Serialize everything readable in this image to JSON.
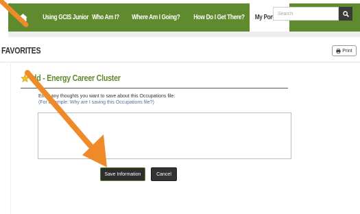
{
  "nav": {
    "items": [
      {
        "label": "Using GCIS Junior"
      },
      {
        "label": "Who Am I?"
      },
      {
        "label": "Where Am I Going?"
      },
      {
        "label": "How Do I Get There?"
      }
    ],
    "active": "My Portfolio",
    "search_placeholder": "Search"
  },
  "page": {
    "title": "FAVORITES",
    "print_label": "Print"
  },
  "section": {
    "title": "dd - Energy Career Cluster",
    "prompt": "Enter any thoughts you want to save about this Occupations file:",
    "example": "(For Example: Why are I saving this Occupations file?)"
  },
  "actions": {
    "save_label": "Save Information",
    "cancel_label": "Cancel"
  },
  "colors": {
    "nav_green": "#5f8a2d",
    "annotation_orange": "#ef8a2a",
    "star_gold": "#f2c21b"
  },
  "icons": {
    "home": "home-icon",
    "search": "search-icon",
    "print": "printer-icon",
    "favorite": "star-icon"
  }
}
